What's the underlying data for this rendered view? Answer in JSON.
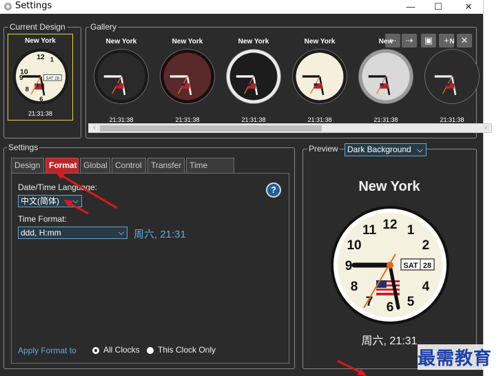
{
  "window": {
    "title": "Settings",
    "minimize": "—",
    "maximize": "☐",
    "close": "✕"
  },
  "current_design": {
    "legend": "Current Design",
    "clock": {
      "city": "New York",
      "time": "21:31:38",
      "date": "SAT",
      "day": "28"
    }
  },
  "gallery": {
    "legend": "Gallery",
    "clocks": [
      {
        "city": "New York",
        "time": "21:31:38",
        "style": "black"
      },
      {
        "city": "New York",
        "time": "21:31:38",
        "style": "maroon"
      },
      {
        "city": "New York",
        "time": "21:31:38",
        "style": "dark-chrome"
      },
      {
        "city": "New York",
        "time": "21:31:38",
        "style": "cream"
      },
      {
        "city": "New",
        "time": "21:31:38",
        "style": "silver"
      },
      {
        "city": "N",
        "time": "21:31:38",
        "style": "transparent"
      }
    ],
    "toolbar_icons": [
      "arrow-left-icon",
      "arrow-right-icon",
      "save-icon",
      "add-icon",
      "remove-icon"
    ],
    "scroll": {
      "left_arrow": "‹",
      "right_arrow": "›"
    }
  },
  "settings": {
    "legend": "Settings",
    "tabs": [
      "Design",
      "Format",
      "Global",
      "Control",
      "Transfer",
      "Time Check"
    ],
    "active_tab": "Format",
    "format": {
      "language_label": "Date/Time Language:",
      "language_value": "中文(简体)",
      "time_format_label": "Time Format:",
      "time_format_value": "ddd, H:mm",
      "time_format_preview": "周六, 21:31",
      "help": "?",
      "apply_label": "Apply Format to",
      "apply_options": [
        "All Clocks",
        "This Clock Only"
      ],
      "apply_selected": "All Clocks"
    }
  },
  "preview": {
    "legend": "Preview",
    "background_value": "Dark Background",
    "city": "New York",
    "date": "SAT",
    "day": "28",
    "time_text": "周六, 21:31",
    "clock_numbers": [
      "12",
      "1",
      "2",
      "3",
      "4",
      "5",
      "6",
      "7",
      "8",
      "9",
      "10",
      "11"
    ]
  },
  "watermark": "最需教育",
  "colors": {
    "window_bg": "#2b2b2b",
    "accent_tab": "#b8262b",
    "link": "#5aaee0",
    "select_bg": "#263a46",
    "selected_border": "#e2d24a",
    "arrow": "#e01818"
  }
}
